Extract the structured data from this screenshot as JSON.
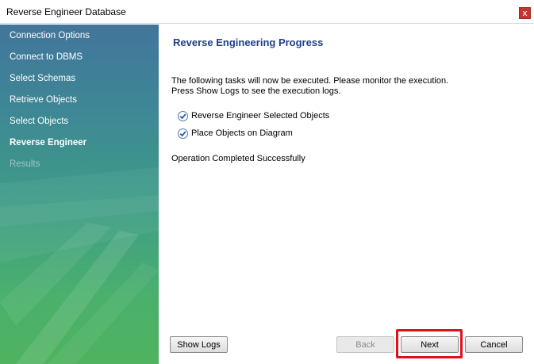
{
  "window": {
    "title": "Reverse Engineer Database",
    "close_label": "x"
  },
  "sidebar": {
    "steps": [
      {
        "label": "Connection Options",
        "state": "done"
      },
      {
        "label": "Connect to DBMS",
        "state": "done"
      },
      {
        "label": "Select Schemas",
        "state": "done"
      },
      {
        "label": "Retrieve Objects",
        "state": "done"
      },
      {
        "label": "Select Objects",
        "state": "done"
      },
      {
        "label": "Reverse Engineer",
        "state": "active"
      },
      {
        "label": "Results",
        "state": "disabled"
      }
    ]
  },
  "main": {
    "heading": "Reverse Engineering Progress",
    "description_line1": "The following tasks will now be executed. Please monitor the execution.",
    "description_line2": "Press Show Logs to see the execution logs.",
    "tasks": [
      {
        "label": "Reverse Engineer Selected Objects",
        "checked": true
      },
      {
        "label": "Place Objects on Diagram",
        "checked": true
      }
    ],
    "status": "Operation Completed Successfully"
  },
  "buttons": {
    "show_logs": "Show Logs",
    "back": "Back",
    "next": "Next",
    "cancel": "Cancel"
  },
  "colors": {
    "accent": "#1f3f86",
    "highlight": "#e0101c",
    "close": "#c7352f"
  }
}
